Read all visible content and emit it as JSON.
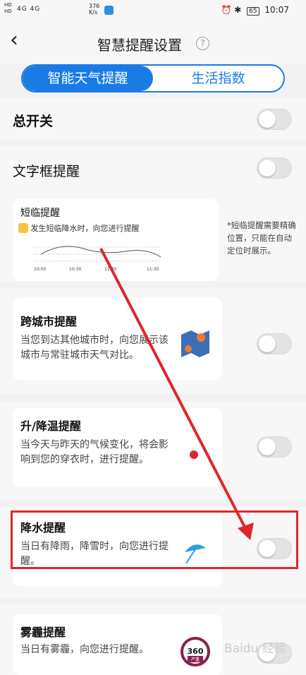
{
  "status_bar": {
    "sim": "HD",
    "signal": "4G 4G",
    "net_speed_value": "376",
    "net_speed_unit": "K/s",
    "battery": "65",
    "time": "10:07"
  },
  "header": {
    "title": "智慧提醒设置",
    "help": "?"
  },
  "tabs": [
    {
      "label": "智能天气提醒",
      "active": true
    },
    {
      "label": "生活指数",
      "active": false
    }
  ],
  "master": {
    "label": "总开关",
    "enabled": false
  },
  "textbox": {
    "label": "文字框提醒",
    "enabled": false
  },
  "nowcast": {
    "title": "短临提醒",
    "banner": "发生短临降水时，向您进行提醒",
    "times": [
      "10:00",
      "10:30",
      "11:00",
      "11:30"
    ],
    "note": "*短临提醒需要精确位置，只能在自动定位时展示。"
  },
  "cards": [
    {
      "title": "跨城市提醒",
      "desc": "当您到达其他城市时，向您展示该城市与常驻城市天气对比。",
      "icon": "map-icon",
      "enabled": false
    },
    {
      "title": "升/降温提醒",
      "desc": "当今天与昨天的气候变化，将会影响到您的穿衣时，进行提醒。",
      "icon": "thermometer-icon",
      "enabled": false
    },
    {
      "title": "降水提醒",
      "desc": "当日有降雨，降雪时，向您进行提醒。",
      "icon": "umbrella-icon",
      "enabled": false
    },
    {
      "title": "雾霾提醒",
      "desc": "当日有雾霾，向您进行提醒。",
      "icon": "aqi-gauge-icon",
      "enabled": false
    }
  ],
  "aqi_gauge": {
    "value": "360",
    "level": "严重"
  },
  "watermark": "Baidu 经验",
  "colors": {
    "accent": "#1a7be6",
    "highlight": "#e0262b",
    "toggle_off": "#e3e3e3"
  }
}
